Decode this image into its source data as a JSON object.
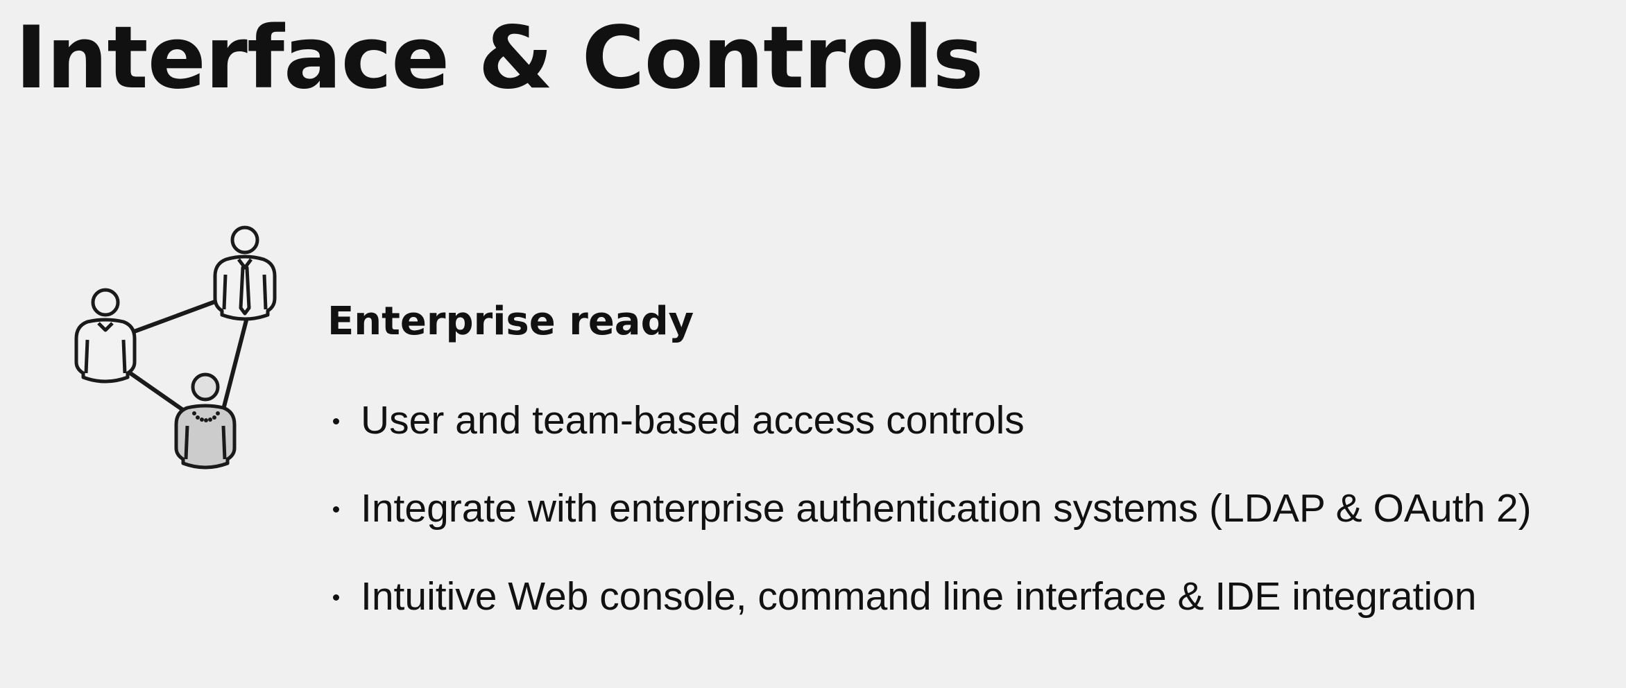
{
  "slide": {
    "title": "Interface & Controls",
    "heading": "Enterprise ready",
    "bullets": [
      "User and team-based access controls",
      "Integrate with enterprise authentication systems (LDAP & OAuth 2)",
      "Intuitive Web console, command line interface & IDE integration"
    ],
    "icon": "team-network-icon"
  },
  "colors": {
    "background": "#f0f0f0",
    "text": "#111111",
    "icon_stroke": "#1a1a1a",
    "icon_fill_light": "#f2f2f2",
    "icon_fill_gray": "#cccccc"
  }
}
